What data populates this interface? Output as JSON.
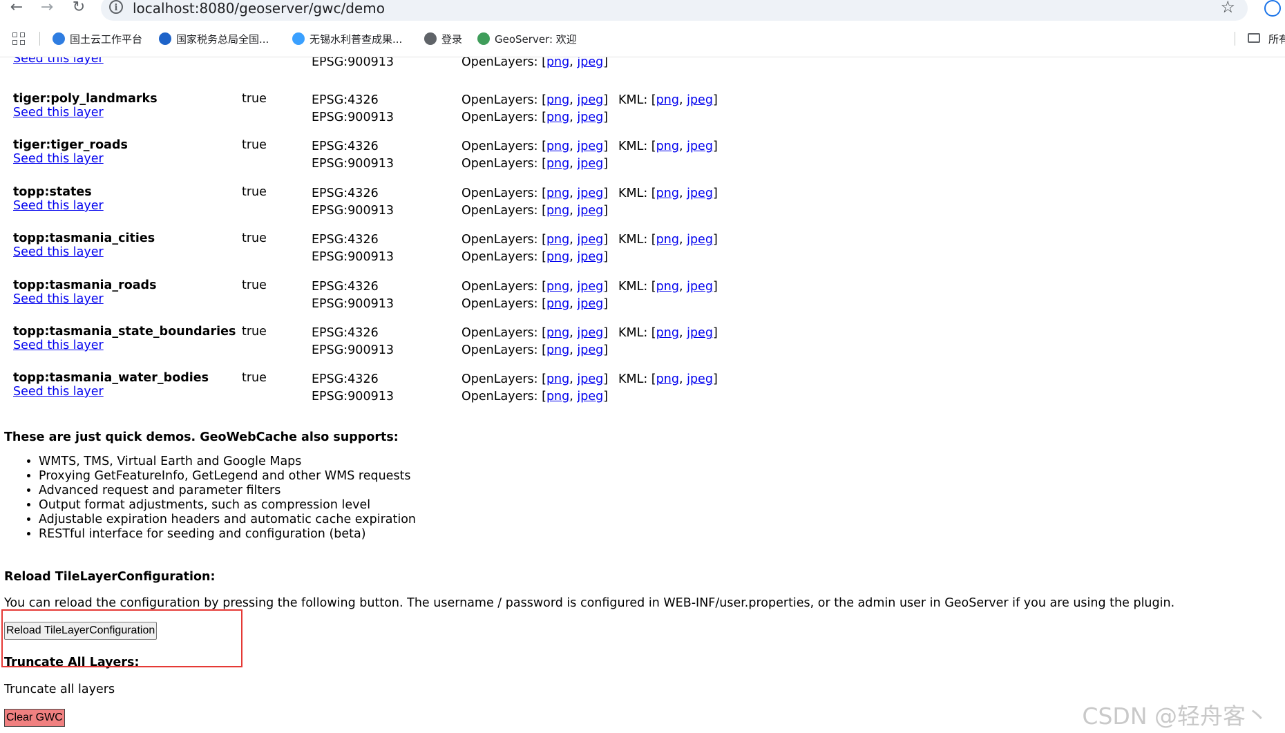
{
  "browser": {
    "url": "localhost:8080/geoserver/gwc/demo",
    "bookmarks": [
      {
        "label": "国土云工作平台",
        "color": "#2f7de1"
      },
      {
        "label": "国家税务总局全国...",
        "color": "#1e63c9"
      },
      {
        "label": "无锡水利普查成果...",
        "color": "#3aa0ff"
      },
      {
        "label": "登录",
        "color": "#5f6368"
      },
      {
        "label": "GeoServer: 欢迎",
        "color": "#3f9d5a"
      }
    ],
    "other_bookmarks": "所有"
  },
  "partial_row": {
    "seed_label": "Seed this layer",
    "srs2": "EPSG:900913",
    "ol_label": "OpenLayers:",
    "fmt_png": "png",
    "fmt_jpeg": "jpeg"
  },
  "layers": [
    {
      "name": "tiger:poly_landmarks",
      "enabled": "true",
      "srs1": "EPSG:4326",
      "srs2": "EPSG:900913",
      "seed_label": "Seed this layer",
      "ol_label": "OpenLayers:",
      "kml_label": "KML:",
      "png": "png",
      "jpeg": "jpeg"
    },
    {
      "name": "tiger:tiger_roads",
      "enabled": "true",
      "srs1": "EPSG:4326",
      "srs2": "EPSG:900913",
      "seed_label": "Seed this layer",
      "ol_label": "OpenLayers:",
      "kml_label": "KML:",
      "png": "png",
      "jpeg": "jpeg"
    },
    {
      "name": "topp:states",
      "enabled": "true",
      "srs1": "EPSG:4326",
      "srs2": "EPSG:900913",
      "seed_label": "Seed this layer",
      "ol_label": "OpenLayers:",
      "kml_label": "KML:",
      "png": "png",
      "jpeg": "jpeg"
    },
    {
      "name": "topp:tasmania_cities",
      "enabled": "true",
      "srs1": "EPSG:4326",
      "srs2": "EPSG:900913",
      "seed_label": "Seed this layer",
      "ol_label": "OpenLayers:",
      "kml_label": "KML:",
      "png": "png",
      "jpeg": "jpeg"
    },
    {
      "name": "topp:tasmania_roads",
      "enabled": "true",
      "srs1": "EPSG:4326",
      "srs2": "EPSG:900913",
      "seed_label": "Seed this layer",
      "ol_label": "OpenLayers:",
      "kml_label": "KML:",
      "png": "png",
      "jpeg": "jpeg"
    },
    {
      "name": "topp:tasmania_state_boundaries",
      "enabled": "true",
      "srs1": "EPSG:4326",
      "srs2": "EPSG:900913",
      "seed_label": "Seed this layer",
      "ol_label": "OpenLayers:",
      "kml_label": "KML:",
      "png": "png",
      "jpeg": "jpeg"
    },
    {
      "name": "topp:tasmania_water_bodies",
      "enabled": "true",
      "srs1": "EPSG:4326",
      "srs2": "EPSG:900913",
      "seed_label": "Seed this layer",
      "ol_label": "OpenLayers:",
      "kml_label": "KML:",
      "png": "png",
      "jpeg": "jpeg"
    }
  ],
  "demos": {
    "heading": "These are just quick demos. GeoWebCache also supports:",
    "items": [
      "WMTS, TMS, Virtual Earth and Google Maps",
      "Proxying GetFeatureInfo, GetLegend and other WMS requests",
      "Advanced request and parameter filters",
      "Output format adjustments, such as compression level",
      "Adjustable expiration headers and automatic cache expiration",
      "RESTful interface for seeding and configuration (beta)"
    ]
  },
  "reload": {
    "heading": "Reload TileLayerConfiguration:",
    "text": "You can reload the configuration by pressing the following button. The username / password is configured in WEB-INF/user.properties, or the admin user in GeoServer if you are using the plugin.",
    "button_label": "Reload TileLayerConfiguration"
  },
  "truncate": {
    "heading": "Truncate All Layers:",
    "text": "Truncate all layers",
    "button_label": "Clear GWC"
  },
  "watermark": "CSDN @轻舟客丶",
  "colors": {
    "link": "#0000ee",
    "highlight_box": "#e53935",
    "clear_button": "#f08080"
  }
}
